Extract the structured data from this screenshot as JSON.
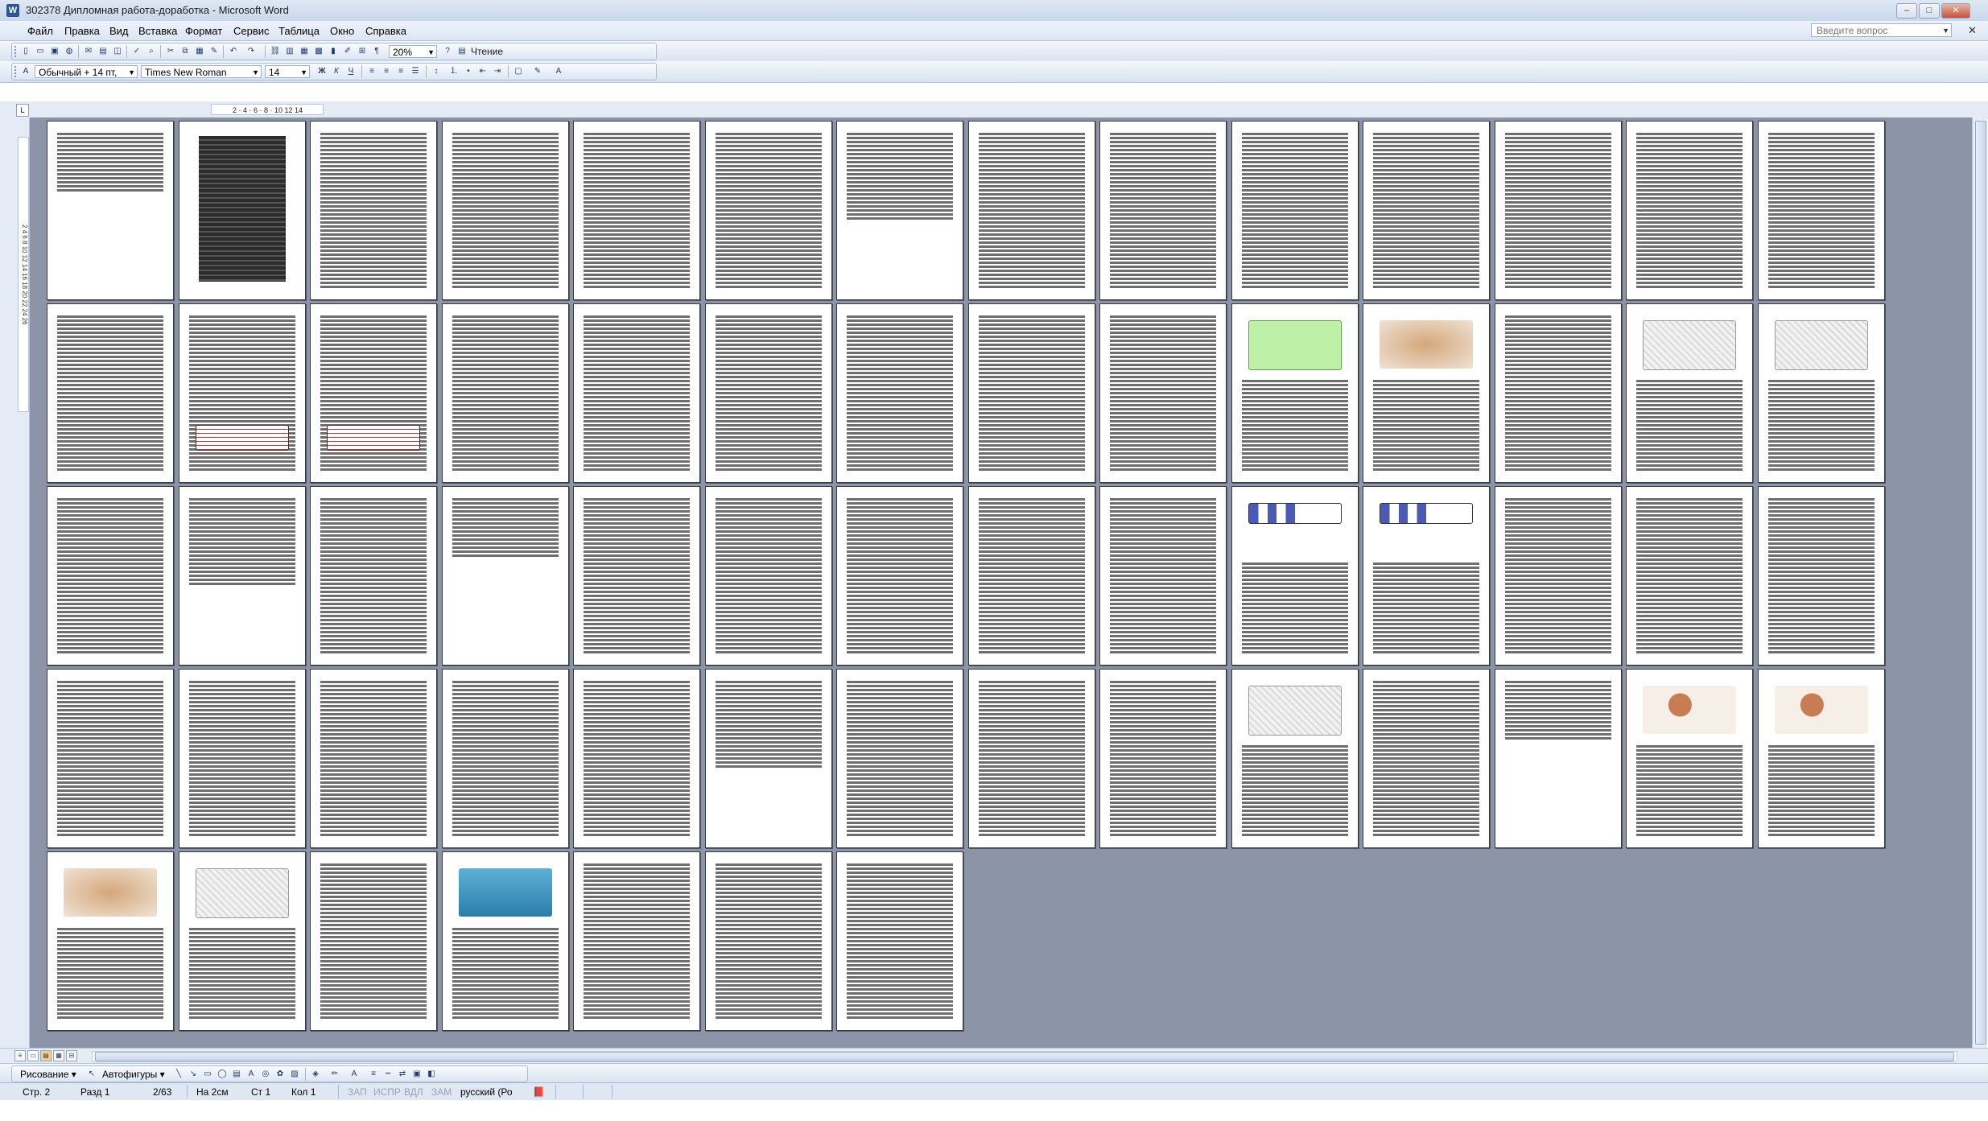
{
  "window": {
    "title": "302378 Дипломная работа-доработка - Microsoft Word",
    "app_icon": "W",
    "minimize": "–",
    "maximize": "□",
    "close": "✕"
  },
  "menu": {
    "items": [
      "Файл",
      "Правка",
      "Вид",
      "Вставка",
      "Формат",
      "Сервис",
      "Таблица",
      "Окно",
      "Справка"
    ],
    "help_placeholder": "Введите вопрос",
    "close_doc": "✕"
  },
  "toolbar_standard": {
    "zoom": "20%",
    "reading_label": "Чтение",
    "icons": [
      "new-icon",
      "open-icon",
      "save-icon",
      "permission-icon",
      "email-icon",
      "print-icon",
      "print-preview-icon",
      "spelling-icon",
      "research-icon",
      "cut-icon",
      "copy-icon",
      "paste-icon",
      "format-painter-icon",
      "undo-icon",
      "redo-icon",
      "hyperlink-icon",
      "tables-borders-icon",
      "insert-table-icon",
      "insert-excel-icon",
      "columns-icon",
      "drawing-icon",
      "document-map-icon",
      "show-formatting-icon"
    ]
  },
  "toolbar_formatting": {
    "style": "Обычный + 14 пт,",
    "font": "Times New Roman",
    "size": "14",
    "bold": "Ж",
    "italic": "К",
    "underline": "Ч"
  },
  "ruler": {
    "corner": "L",
    "marks": "2 · 4 · 6 · 8 · 10 12 14",
    "vmarks": "2 4 6 8 10 12 14 16 18 20 22 24 26"
  },
  "document": {
    "pages": [
      {
        "type": "sparse"
      },
      {
        "type": "dark"
      },
      {
        "type": "text"
      },
      {
        "type": "text"
      },
      {
        "type": "text"
      },
      {
        "type": "text"
      },
      {
        "type": "half"
      },
      {
        "type": "text"
      },
      {
        "type": "text"
      },
      {
        "type": "text"
      },
      {
        "type": "text"
      },
      {
        "type": "text"
      },
      {
        "type": "text"
      },
      {
        "type": "text"
      },
      {
        "type": "text"
      },
      {
        "type": "table"
      },
      {
        "type": "table"
      },
      {
        "type": "text"
      },
      {
        "type": "text"
      },
      {
        "type": "text"
      },
      {
        "type": "text"
      },
      {
        "type": "text"
      },
      {
        "type": "text"
      },
      {
        "type": "green"
      },
      {
        "type": "photo"
      },
      {
        "type": "text"
      },
      {
        "type": "sketch"
      },
      {
        "type": "sketch"
      },
      {
        "type": "text"
      },
      {
        "type": "half"
      },
      {
        "type": "text"
      },
      {
        "type": "sparse"
      },
      {
        "type": "text"
      },
      {
        "type": "text"
      },
      {
        "type": "text"
      },
      {
        "type": "text"
      },
      {
        "type": "text"
      },
      {
        "type": "chart"
      },
      {
        "type": "chart"
      },
      {
        "type": "text"
      },
      {
        "type": "text"
      },
      {
        "type": "text"
      },
      {
        "type": "text"
      },
      {
        "type": "text"
      },
      {
        "type": "text"
      },
      {
        "type": "text"
      },
      {
        "type": "text"
      },
      {
        "type": "half"
      },
      {
        "type": "text"
      },
      {
        "type": "text"
      },
      {
        "type": "text"
      },
      {
        "type": "sketch"
      },
      {
        "type": "text"
      },
      {
        "type": "sparse"
      },
      {
        "type": "people"
      },
      {
        "type": "people"
      },
      {
        "type": "photo"
      },
      {
        "type": "sketch"
      },
      {
        "type": "text"
      },
      {
        "type": "water"
      },
      {
        "type": "text"
      },
      {
        "type": "text"
      },
      {
        "type": "text"
      }
    ]
  },
  "view_buttons": [
    "≡",
    "▭",
    "▤",
    "▦",
    "⊟"
  ],
  "drawing_toolbar": {
    "draw_label": "Рисование ▾",
    "autoshapes_label": "Автофигуры ▾"
  },
  "status": {
    "page": "Стр. 2",
    "section": "Разд 1",
    "page_of": "2/63",
    "at": "На 2см",
    "line": "Ст 1",
    "col": "Кол 1",
    "rec": "ЗАП",
    "trk": "ИСПР",
    "ext": "ВДЛ",
    "ovr": "ЗАМ",
    "language": "русский (Ро"
  }
}
